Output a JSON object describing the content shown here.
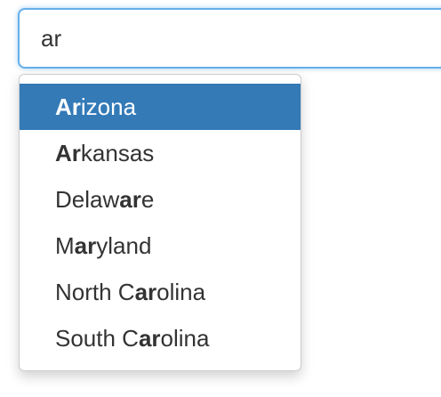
{
  "search": {
    "value": "ar"
  },
  "suggestions": [
    {
      "before": "",
      "match": "Ar",
      "after": "izona",
      "active": true
    },
    {
      "before": "",
      "match": "Ar",
      "after": "kansas",
      "active": false
    },
    {
      "before": "Delaw",
      "match": "ar",
      "after": "e",
      "active": false
    },
    {
      "before": "M",
      "match": "ar",
      "after": "yland",
      "active": false
    },
    {
      "before": "North C",
      "match": "ar",
      "after": "olina",
      "active": false
    },
    {
      "before": "South C",
      "match": "ar",
      "after": "olina",
      "active": false
    }
  ],
  "colors": {
    "active_background": "#337ab7",
    "input_focus_border": "#66afe9"
  }
}
